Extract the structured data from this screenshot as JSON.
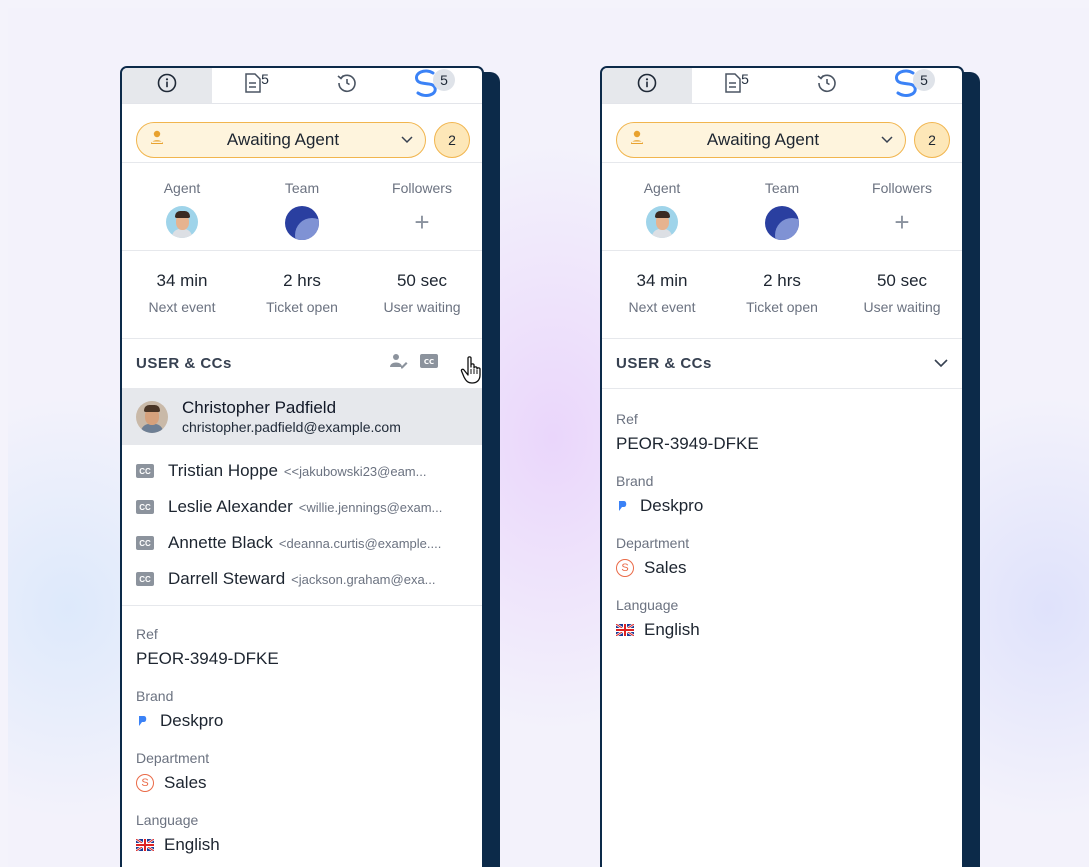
{
  "panels": [
    {
      "tabs": [
        {
          "icon": "info-icon",
          "badge": ""
        },
        {
          "icon": "document-icon",
          "badge": "5"
        },
        {
          "icon": "history-icon",
          "badge": ""
        },
        {
          "icon": "deskpro-apps-icon",
          "badge": "5"
        }
      ],
      "status": {
        "label": "Awaiting Agent",
        "count": "2"
      },
      "people": {
        "agent_label": "Agent",
        "team_label": "Team",
        "followers_label": "Followers",
        "followers_add": "+"
      },
      "stats": [
        {
          "value": "34 min",
          "label": "Next event"
        },
        {
          "value": "2 hrs",
          "label": "Ticket open"
        },
        {
          "value": "50 sec",
          "label": "User waiting"
        }
      ],
      "section_title": "USER & CCs",
      "user": {
        "name": "Christopher Padfield",
        "email": "christopher.padfield@example.com"
      },
      "ccs": [
        {
          "name": "Tristian Hoppe",
          "email": "<<jakubowski23@eam..."
        },
        {
          "name": "Leslie Alexander",
          "email": "<willie.jennings@exam..."
        },
        {
          "name": "Annette Black",
          "email": "<deanna.curtis@example...."
        },
        {
          "name": "Darrell Steward",
          "email": "<jackson.graham@exa..."
        }
      ],
      "fields": {
        "ref_label": "Ref",
        "ref_value": "PEOR-3949-DFKE",
        "brand_label": "Brand",
        "brand_value": "Deskpro",
        "dept_label": "Department",
        "dept_value": "Sales",
        "dept_icon_letter": "S",
        "lang_label": "Language",
        "lang_value": "English"
      }
    },
    {
      "tabs": [
        {
          "icon": "info-icon",
          "badge": ""
        },
        {
          "icon": "document-icon",
          "badge": "5"
        },
        {
          "icon": "history-icon",
          "badge": ""
        },
        {
          "icon": "deskpro-apps-icon",
          "badge": "5"
        }
      ],
      "status": {
        "label": "Awaiting Agent",
        "count": "2"
      },
      "people": {
        "agent_label": "Agent",
        "team_label": "Team",
        "followers_label": "Followers",
        "followers_add": "+"
      },
      "stats": [
        {
          "value": "34 min",
          "label": "Next event"
        },
        {
          "value": "2 hrs",
          "label": "Ticket open"
        },
        {
          "value": "50 sec",
          "label": "User waiting"
        }
      ],
      "section_title": "USER & CCs",
      "fields": {
        "ref_label": "Ref",
        "ref_value": "PEOR-3949-DFKE",
        "brand_label": "Brand",
        "brand_value": "Deskpro",
        "dept_label": "Department",
        "dept_value": "Sales",
        "dept_icon_letter": "S",
        "lang_label": "Language",
        "lang_value": "English"
      }
    }
  ],
  "colors": {
    "navy": "#0c2a49",
    "status_border": "#f1b54e",
    "status_bg": "#fef4dd",
    "accent_blue": "#3b82f6",
    "sales_orange": "#ea6a47"
  }
}
